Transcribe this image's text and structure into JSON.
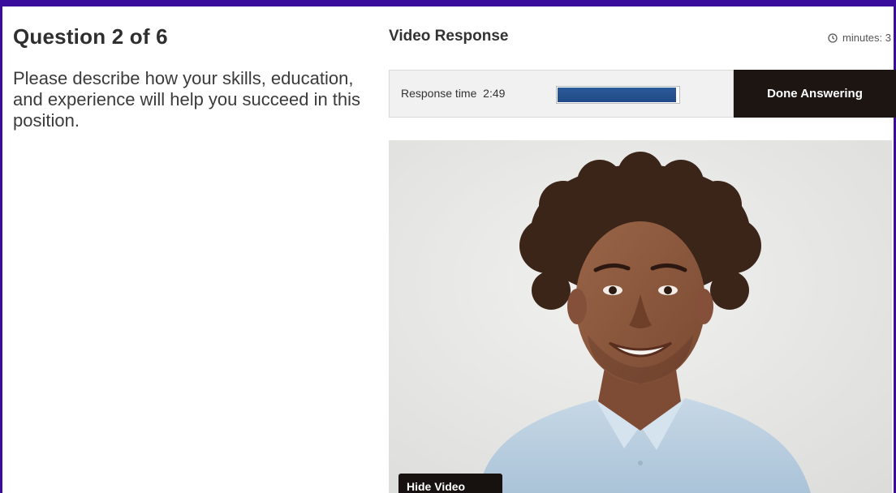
{
  "question": {
    "title": "Question 2 of 6",
    "text": "Please describe how your skills, education, and experience will help you succeed in this position."
  },
  "video_response": {
    "title": "Video Response",
    "minutes_label": "minutes: 3",
    "minutes_icon": "clock-icon",
    "response_time_label": "Response time",
    "response_time_value": "2:49",
    "progress_fraction": 0.98,
    "done_button": "Done Answering",
    "hide_video_button": "Hide Video"
  },
  "colors": {
    "frame": "#3a0d9c",
    "progress": "#1f4a86",
    "done_button_bg": "#1c1511"
  }
}
